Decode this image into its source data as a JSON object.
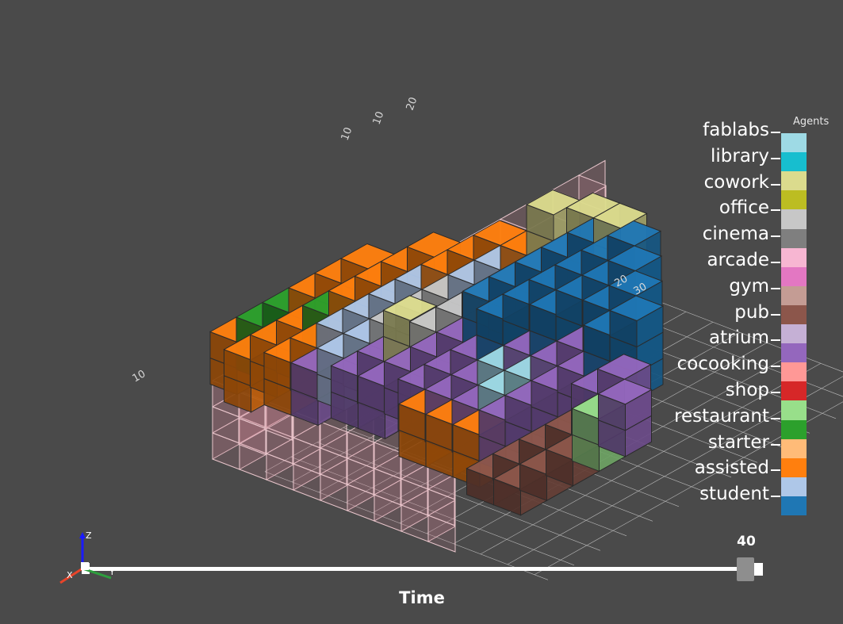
{
  "viewport": {
    "background": "#4a4a4a",
    "bounds_color": "#b9b9b9",
    "axis_labels": [
      "10",
      "20",
      "30",
      "20",
      "10",
      "10"
    ]
  },
  "legend": {
    "title": "Agents",
    "entries": [
      {
        "label": "fablabs",
        "color": "#9edae5"
      },
      {
        "label": "library",
        "color": "#17becf"
      },
      {
        "label": "cowork",
        "color": "#dbdb8d"
      },
      {
        "label": "office",
        "color": "#bcbd22"
      },
      {
        "label": "cinema",
        "color": "#c7c7c7"
      },
      {
        "label": "arcade",
        "color": "#7f7f7f"
      },
      {
        "label": "gym",
        "color": "#f7b6d2"
      },
      {
        "label": "pub",
        "color": "#e377c2"
      },
      {
        "label": "atrium",
        "color": "#c49c94"
      },
      {
        "label": "cocooking",
        "color": "#8c564b"
      },
      {
        "label": "shop",
        "color": "#c5b0d5"
      },
      {
        "label": "restaurant",
        "color": "#9467bd"
      },
      {
        "label": "starter",
        "color": "#ff9896"
      },
      {
        "label": "assisted",
        "color": "#d62728"
      },
      {
        "label": "student",
        "color": "#98df8a"
      }
    ],
    "colorbar": [
      "#9edae5",
      "#17becf",
      "#dbdb8d",
      "#bcbd22",
      "#c7c7c7",
      "#7f7f7f",
      "#f7b6d2",
      "#e377c2",
      "#c49c94",
      "#8c564b",
      "#c5b0d5",
      "#9467bd",
      "#ff9896",
      "#d62728",
      "#98df8a",
      "#2ca02c",
      "#ffbb78",
      "#ff7f0e",
      "#aec7e8",
      "#1f77b4"
    ]
  },
  "slider": {
    "title": "Time",
    "value": "40",
    "position_fraction": 1.0
  },
  "orientation_axes": {
    "x": "X",
    "y": "Y",
    "z": "Z"
  }
}
